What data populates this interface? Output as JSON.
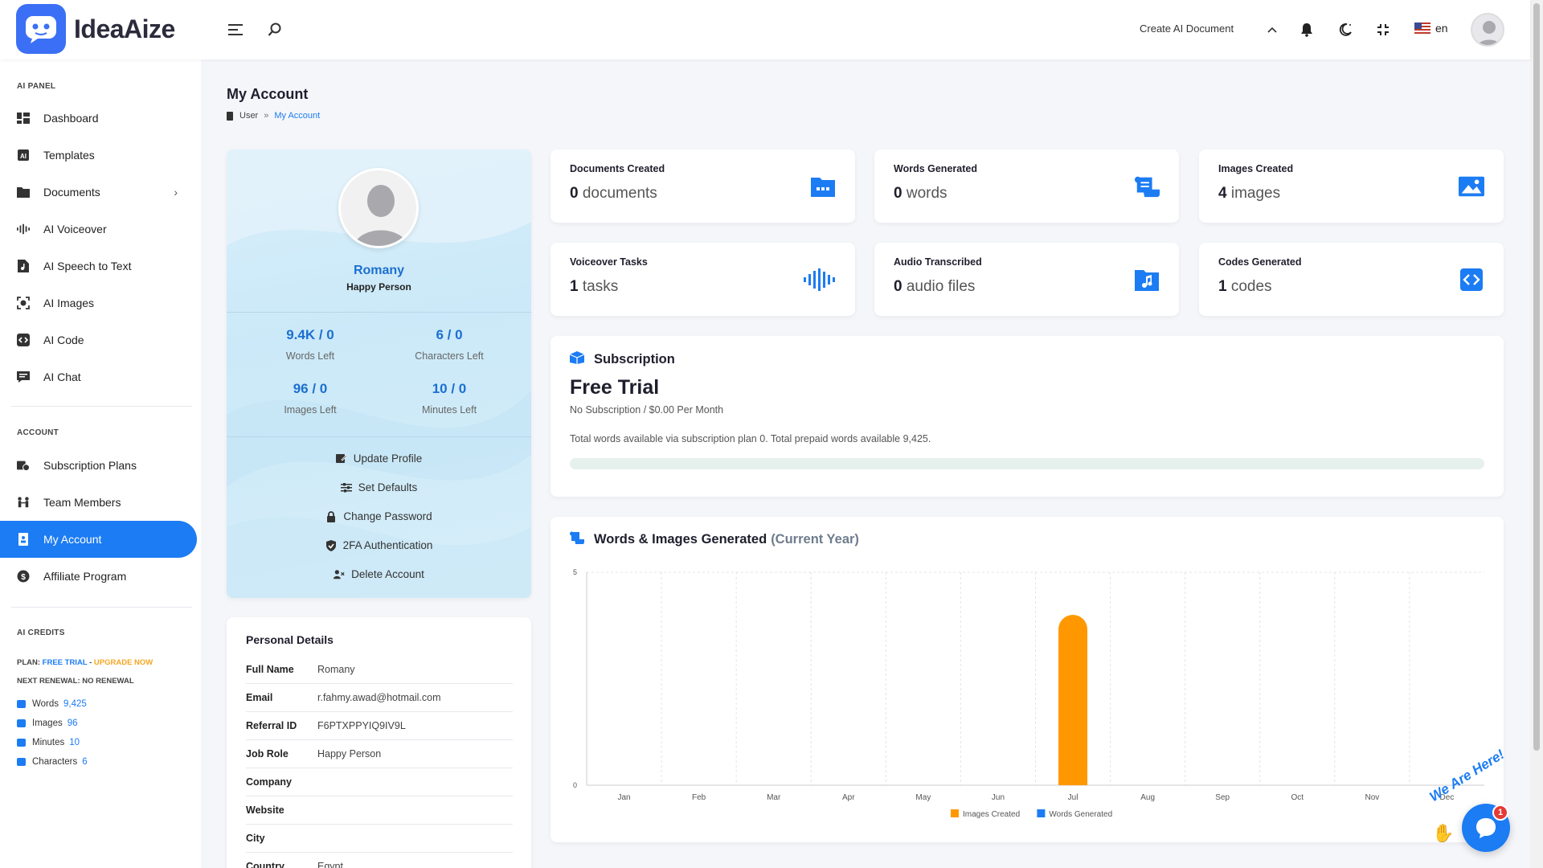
{
  "app": {
    "name": "IdeaAize"
  },
  "header": {
    "create_label": "Create AI Document",
    "lang": "en"
  },
  "sidebar": {
    "ai_panel_title": "AI PANEL",
    "ai_items": [
      {
        "label": "Dashboard",
        "icon": "dashboard-icon"
      },
      {
        "label": "Templates",
        "icon": "templates-icon"
      },
      {
        "label": "Documents",
        "icon": "documents-icon"
      },
      {
        "label": "AI Voiceover",
        "icon": "voiceover-icon"
      },
      {
        "label": "AI Speech to Text",
        "icon": "speech-icon"
      },
      {
        "label": "AI Images",
        "icon": "images-icon"
      },
      {
        "label": "AI Code",
        "icon": "code-icon"
      },
      {
        "label": "AI Chat",
        "icon": "chat-icon"
      }
    ],
    "account_title": "ACCOUNT",
    "account_items": [
      {
        "label": "Subscription Plans",
        "icon": "subscription-icon"
      },
      {
        "label": "Team Members",
        "icon": "team-icon"
      },
      {
        "label": "My Account",
        "icon": "account-icon"
      },
      {
        "label": "Affiliate Program",
        "icon": "affiliate-icon"
      }
    ],
    "credits_title": "AI CREDITS",
    "plan_prefix": "PLAN:",
    "plan_name": "FREE TRIAL",
    "plan_dash": " - ",
    "upgrade": "UPGRADE NOW",
    "renewal": "NEXT RENEWAL: NO RENEWAL",
    "credits": [
      {
        "label": "Words",
        "value": "9,425"
      },
      {
        "label": "Images",
        "value": "96"
      },
      {
        "label": "Minutes",
        "value": "10"
      },
      {
        "label": "Characters",
        "value": "6"
      }
    ]
  },
  "page": {
    "title": "My Account",
    "breadcrumb": {
      "root": "User",
      "sep": "»",
      "current": "My Account"
    }
  },
  "profile": {
    "name": "Romany",
    "role": "Happy Person",
    "stats": [
      {
        "value": "9.4K / 0",
        "label": "Words Left"
      },
      {
        "value": "6 / 0",
        "label": "Characters Left"
      },
      {
        "value": "96 / 0",
        "label": "Images Left"
      },
      {
        "value": "10 / 0",
        "label": "Minutes Left"
      }
    ],
    "links": [
      "Update Profile",
      "Set Defaults",
      "Change Password",
      "2FA Authentication",
      "Delete Account"
    ]
  },
  "details": {
    "title": "Personal Details",
    "rows": [
      {
        "k": "Full Name",
        "v": "Romany"
      },
      {
        "k": "Email",
        "v": "r.fahmy.awad@hotmail.com"
      },
      {
        "k": "Referral ID",
        "v": "F6PTXPPYIQ9IV9L"
      },
      {
        "k": "Job Role",
        "v": "Happy Person"
      },
      {
        "k": "Company",
        "v": ""
      },
      {
        "k": "Website",
        "v": ""
      },
      {
        "k": "City",
        "v": ""
      },
      {
        "k": "Country",
        "v": "Egypt"
      }
    ]
  },
  "stat_cards": [
    {
      "title": "Documents Created",
      "num": "0",
      "unit": "documents",
      "icon": "folder-icon"
    },
    {
      "title": "Words Generated",
      "num": "0",
      "unit": "words",
      "icon": "scroll-icon"
    },
    {
      "title": "Images Created",
      "num": "4",
      "unit": "images",
      "icon": "image-icon"
    },
    {
      "title": "Voiceover Tasks",
      "num": "1",
      "unit": "tasks",
      "icon": "waveform-icon"
    },
    {
      "title": "Audio Transcribed",
      "num": "0",
      "unit": "audio files",
      "icon": "music-folder-icon"
    },
    {
      "title": "Codes Generated",
      "num": "1",
      "unit": "codes",
      "icon": "code-box-icon"
    }
  ],
  "subscription": {
    "title": "Subscription",
    "plan": "Free Trial",
    "price": "No Subscription / $0.00 Per Month",
    "desc": "Total words available via subscription plan 0. Total prepaid words available 9,425.",
    "progress": 0
  },
  "chart_card": {
    "title": "Words & Images Generated",
    "subtitle": "(Current Year)"
  },
  "colors": {
    "accent": "#1c7cf3",
    "images": "#ff9800",
    "words": "#1c7cf3"
  },
  "chart_data": {
    "type": "bar",
    "categories": [
      "Jan",
      "Feb",
      "Mar",
      "Apr",
      "May",
      "Jun",
      "Jul",
      "Aug",
      "Sep",
      "Oct",
      "Nov",
      "Dec"
    ],
    "series": [
      {
        "name": "Images Created",
        "values": [
          0,
          0,
          0,
          0,
          0,
          0,
          4,
          0,
          0,
          0,
          0,
          0
        ]
      },
      {
        "name": "Words Generated",
        "values": [
          0,
          0,
          0,
          0,
          0,
          0,
          0,
          0,
          0,
          0,
          0,
          0
        ]
      }
    ],
    "yticks": [
      "5",
      "0"
    ],
    "ylim": [
      0,
      5
    ],
    "legend": "bottom",
    "grid": true
  },
  "chat": {
    "badge": "1",
    "tagline": "We Are Here!"
  }
}
